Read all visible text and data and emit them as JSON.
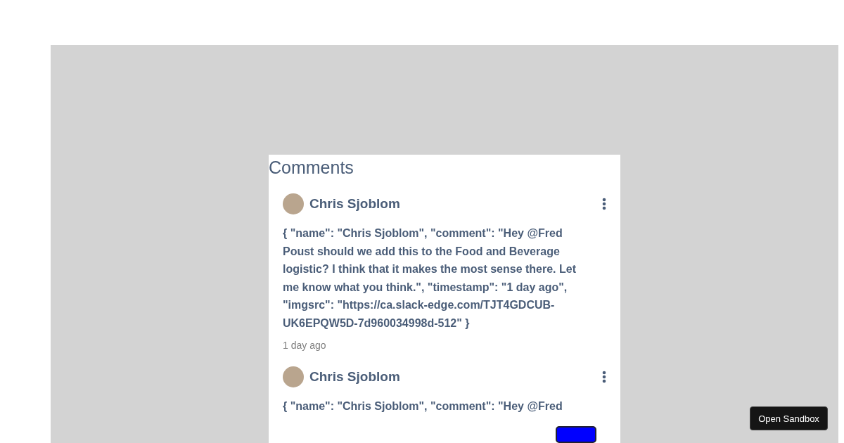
{
  "panel": {
    "title": "Comments"
  },
  "comments": [
    {
      "name": "Chris Sjoblom",
      "text": "{ \"name\": \"Chris Sjoblom\", \"comment\": \"Hey @Fred Poust should we add this to the Food and Beverage logistic? I think that it makes the most sense there. Let me know what you think.\", \"timestamp\": \"1 day ago\", \"imgsrc\": \"https://ca.slack-edge.com/TJT4GDCUB-UK6EPQW5D-7d960034998d-512\" }",
      "timestamp": "1 day ago"
    },
    {
      "name": "Chris Sjoblom",
      "text": "{ \"name\": \"Chris Sjoblom\", \"comment\": \"Hey @Fred"
    }
  ],
  "open_sandbox": {
    "label": "Open Sandbox"
  }
}
